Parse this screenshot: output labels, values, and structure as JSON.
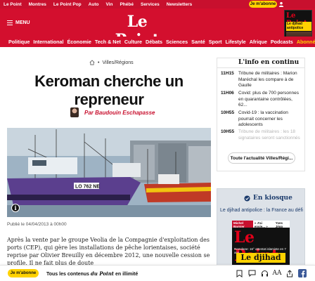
{
  "topbar": {
    "links": [
      "Le Point",
      "Montres",
      "Le Point Pop",
      "Auto",
      "Vin",
      "Phébé",
      "Services",
      "Newsletters"
    ],
    "subscribe_label": "Je m'abonne"
  },
  "header": {
    "menu_label": "MENU",
    "logo": "Le Point",
    "cover": {
      "title": "Le Point",
      "headline": "Le djihad antipolice"
    }
  },
  "nav": {
    "items": [
      "Politique",
      "International",
      "Économie",
      "Tech & Net",
      "Culture",
      "Débats",
      "Sciences",
      "Santé",
      "Sport",
      "Lifestyle",
      "Afrique",
      "Podcasts",
      "Abonnés"
    ],
    "active_index": 12
  },
  "article": {
    "breadcrumb_separator": "•",
    "section": "Villes/Régions",
    "title": "Keroman cherche un repreneur",
    "author": "Par Baudouin Eschapasse",
    "photo_caption_text": "LO 762 NE",
    "published": "Publié le 04/04/2013 à 00h00",
    "body": "Après la vente par le groupe Veolia de la Compagnie d'exploitation des ports (CEP), qui gère les installations de pêche lorientaises, société reprise par Olivier Breuilly en décembre 2012, une nouvelle cession se profile. Il ne fait plus de doute"
  },
  "live": {
    "title": "L'info en continu",
    "items": [
      {
        "time": "11H15",
        "text": "Tribune de militaires : Marion Maréchal les compare à de Gaulle",
        "faded": false
      },
      {
        "time": "11H06",
        "text": "Covid: plus de 700 personnes en quarantaine contrôlées, 62...",
        "faded": false
      },
      {
        "time": "10H55",
        "text": "Covid-19 : la vaccination pourrait concerner les adolescents",
        "faded": false
      },
      {
        "time": "10H55",
        "text": "Tribune de militaires : les 18 signataires seront sanctionnés",
        "faded": true
      }
    ],
    "all_button": "Toute l'actualité Villes/Régi..."
  },
  "kiosk": {
    "title": "En kiosque",
    "subtitle": "Le djihad antipolice : la France au défi",
    "mag_topline": [
      "Michel Barnier",
      "« J'ai envie... »",
      "Yves Jégo"
    ],
    "mag_logo": "Le Point",
    "mag_line": "Ramdane: 16° attentat islamiste en 7 ans",
    "mag_banner": "Le djihad"
  },
  "bottombar": {
    "subscribe_label": "Je m'abonne",
    "text_before": "Tous les contenus ",
    "text_em": "du Point",
    "text_after": " en illimité",
    "aa_label": "AA"
  },
  "colors": {
    "brand_red": "#d30f2e",
    "accent_yellow": "#ffd200",
    "author_red": "#c8102e",
    "kiosk_blue": "#1a3a6b"
  }
}
